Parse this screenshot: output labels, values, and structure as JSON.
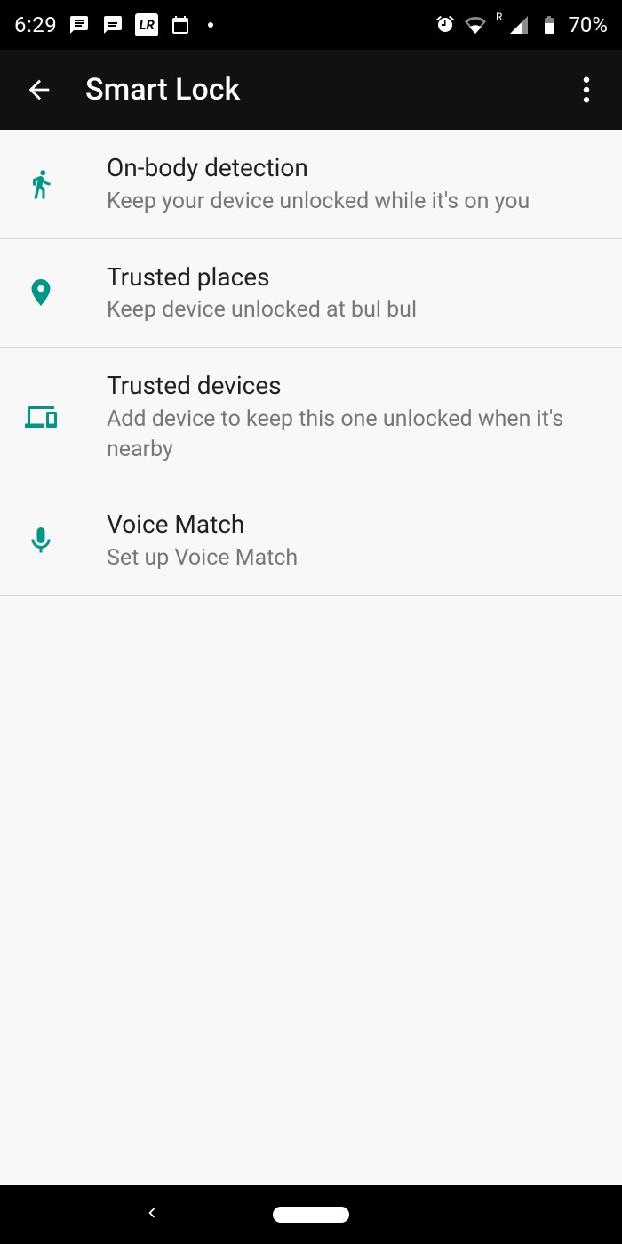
{
  "statusBar": {
    "time": "6:29",
    "battery": "70%",
    "signalLabel": "R"
  },
  "header": {
    "title": "Smart Lock"
  },
  "settings": [
    {
      "icon": "walk-icon",
      "title": "On-body detection",
      "subtitle": "Keep your device unlocked while it's on you"
    },
    {
      "icon": "place-icon",
      "title": "Trusted places",
      "subtitle": "Keep device unlocked at bul bul"
    },
    {
      "icon": "devices-icon",
      "title": "Trusted devices",
      "subtitle": "Add device to keep this one unlocked when it's nearby"
    },
    {
      "icon": "mic-icon",
      "title": "Voice Match",
      "subtitle": "Set up Voice Match"
    }
  ]
}
